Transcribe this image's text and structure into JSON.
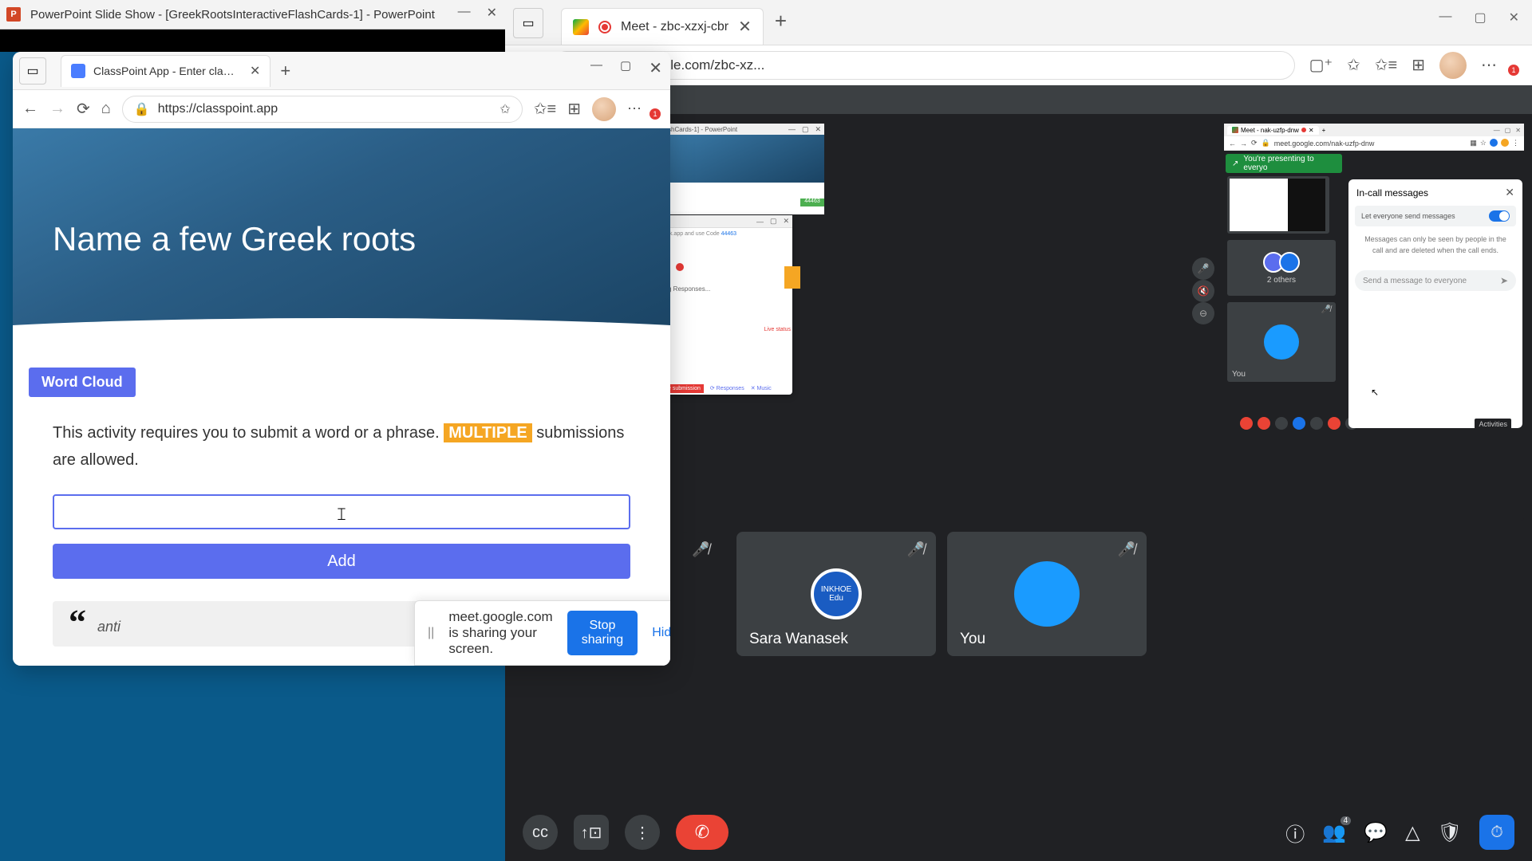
{
  "ppt": {
    "title": "PowerPoint Slide Show - [GreekRootsInteractiveFlashCards-1] - PowerPoint",
    "icon_letter": "P"
  },
  "edge_left": {
    "tab_title": "ClassPoint App - Enter class code",
    "url": "https://classpoint.app",
    "slide_heading": "Name a few Greek roots",
    "word_cloud_label": "Word Cloud",
    "desc_pre": "This activity requires you to submit a word or a phrase. ",
    "desc_multiple": "MULTIPLE",
    "desc_post": " submissions are allowed.",
    "add_button": "Add",
    "quote_word": "anti"
  },
  "share_banner": {
    "text": "meet.google.com is sharing your screen.",
    "stop": "Stop sharing",
    "hide": "Hide"
  },
  "edge_right": {
    "tab_title": "Meet - zbc-xzxj-cbr",
    "url": "https://meet.google.com/zbc-xz...",
    "tiles": {
      "sara": "Sara Wanasek",
      "sara_avatar": "INKHOE Edu",
      "you": "You"
    },
    "shared": {
      "mini_ppt_title": "shCards-1] - PowerPoint",
      "mini_meet_title": "Meet - nak-uzfp-dnw",
      "mini_meet_url": "meet.google.com/nak-uzfp-dnw",
      "green_badge": "44463",
      "live_status": "Live status",
      "responses_text": "g Responses...",
      "mini_submission": "e submission",
      "mini_resp_label": "Responses",
      "mini_music": "Music",
      "presenting": "You're presenting to everyo",
      "others": "2 others",
      "you_label": "You",
      "activities_tip": "Activities",
      "incall": {
        "title": "In-call messages",
        "toggle": "Let everyone send messages",
        "note": "Messages can only be seen by people in the call and are deleted when the call ends.",
        "placeholder": "Send a message to everyone"
      }
    },
    "people_badge": "4"
  }
}
